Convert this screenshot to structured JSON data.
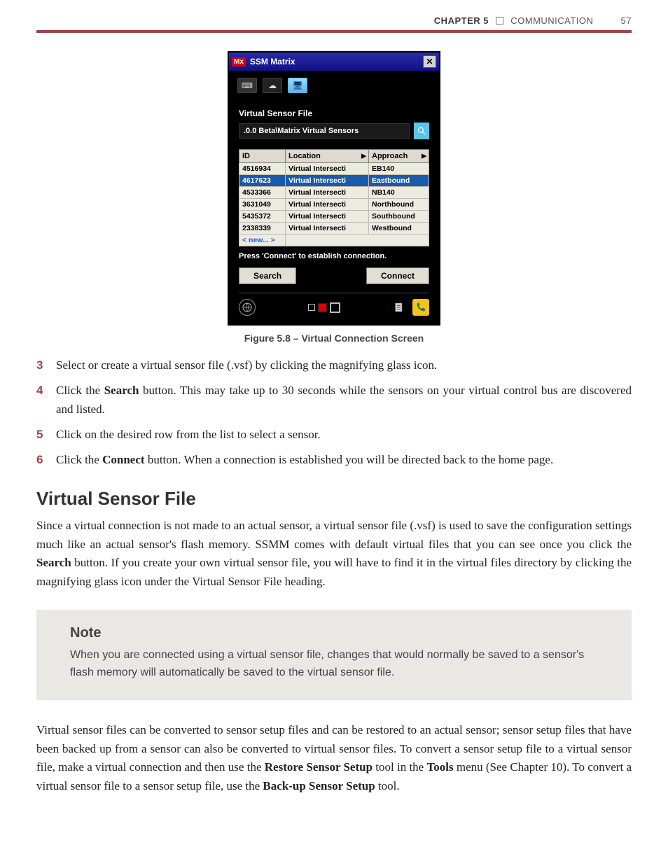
{
  "header": {
    "chapter_label": "CHAPTER 5",
    "chapter_title": "COMMUNICATION",
    "page_number": "57"
  },
  "ssm": {
    "title_prefix": "Mx",
    "title": "SSM Matrix",
    "close_glyph": "✕",
    "toolbar": {
      "serial_icon_title": "serial",
      "cloud_icon_title": "cloud",
      "virtual_icon_title": "virtual"
    },
    "vsf_label": "Virtual Sensor File",
    "vsf_path": ".0.0 Beta\\Matrix Virtual Sensors",
    "columns": {
      "id": "ID",
      "location": "Location",
      "approach": "Approach"
    },
    "rows": [
      {
        "id": "4516934",
        "location": "Virtual Intersecti",
        "approach": "EB140",
        "selected": false
      },
      {
        "id": "4617623",
        "location": "Virtual Intersecti",
        "approach": "Eastbound",
        "selected": true
      },
      {
        "id": "4533366",
        "location": "Virtual Intersecti",
        "approach": "NB140",
        "selected": false
      },
      {
        "id": "3631049",
        "location": "Virtual Intersecti",
        "approach": "Northbound",
        "selected": false
      },
      {
        "id": "5435372",
        "location": "Virtual Intersecti",
        "approach": "Southbound",
        "selected": false
      },
      {
        "id": "2338339",
        "location": "Virtual Intersecti",
        "approach": "Westbound",
        "selected": false
      }
    ],
    "new_row_label": "< new... >",
    "status_line": "Press 'Connect' to establish connection.",
    "search_label": "Search",
    "connect_label": "Connect"
  },
  "figure_caption": "Figure 5.8 – Virtual Connection Screen",
  "steps": [
    {
      "num": "3",
      "html": "Select or create a virtual sensor file (.vsf) by clicking the magnifying glass icon."
    },
    {
      "num": "4",
      "html": "Click the <b>Search</b> button. This may take up to 30 seconds while the sensors on your virtual control bus are discovered and listed."
    },
    {
      "num": "5",
      "html": "Click on the desired row from the list to select a sensor."
    },
    {
      "num": "6",
      "html": "Click the <b>Connect</b> button. When a connection is established you will be directed back to the home page."
    }
  ],
  "section_title": "Virtual Sensor File",
  "section_para": "Since a virtual connection is not made to an actual sensor, a virtual sensor file (.vsf) is used to save the configuration settings much like an actual sensor's flash memory. SSMM comes with default virtual files that you can see once you click the <b>Search</b> button. If you create your own virtual sensor file, you will have to find it in the virtual files directory by clicking the magnifying glass icon under the Virtual Sensor File heading.",
  "note": {
    "title": "Note",
    "text": "When you are connected using a virtual sensor file, changes that would normally be saved to a sensor's flash memory will automatically be saved to the virtual sensor file."
  },
  "closing_para": "Virtual sensor files can be converted to sensor setup files and can be restored to an actual sensor; sensor setup files that have been backed up from a sensor can also be converted to virtual sensor files. To convert a sensor setup file to a virtual sensor file, make a virtual connection and then use the <b>Restore Sensor Setup</b> tool in the <b>Tools</b> menu (See Chapter 10). To convert a virtual sensor file to a sensor setup file, use the <b>Back-up Sensor Setup</b> tool."
}
